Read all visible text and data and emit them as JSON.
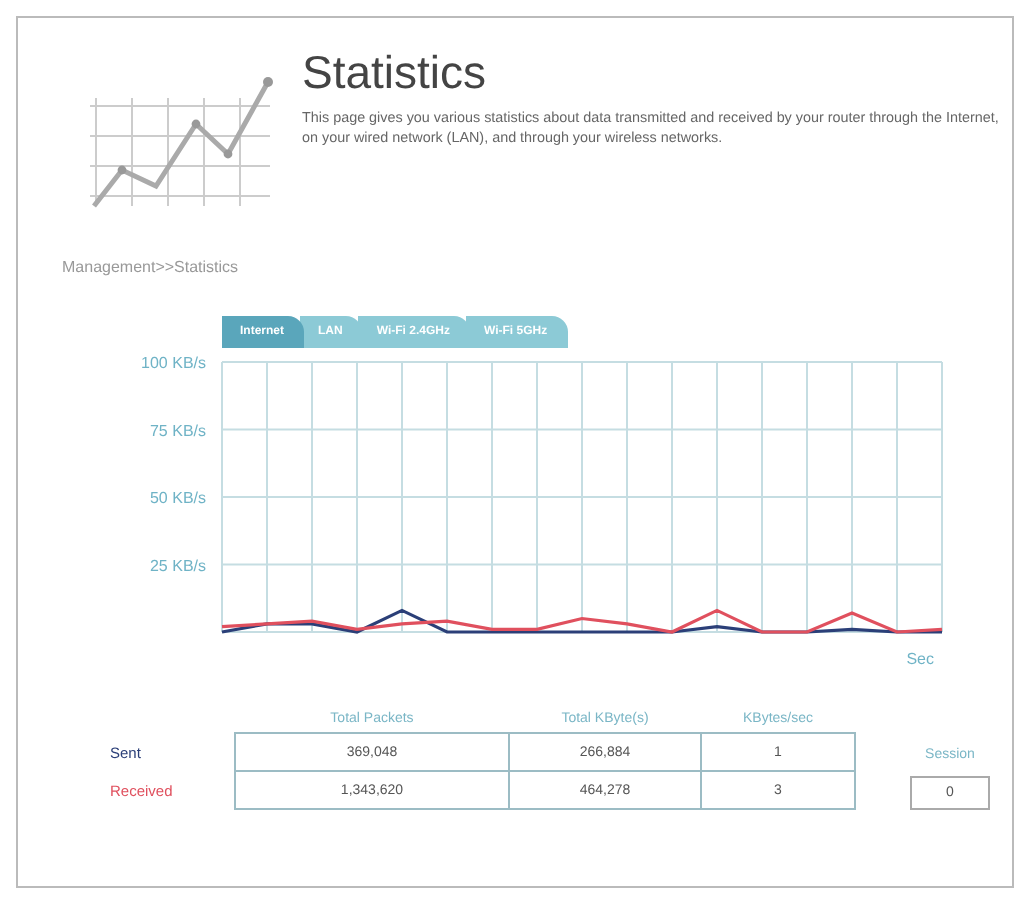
{
  "header": {
    "title": "Statistics",
    "description": "This page gives you various statistics about data transmitted and received by your router through the Internet, on your wired network (LAN), and through your wireless networks."
  },
  "breadcrumb": "Management>>Statistics",
  "tabs": [
    {
      "label": "Internet",
      "selected": true
    },
    {
      "label": "LAN",
      "selected": false
    },
    {
      "label": "Wi-Fi 2.4GHz",
      "selected": false
    },
    {
      "label": "Wi-Fi 5GHz",
      "selected": false
    }
  ],
  "chart": {
    "chart_data": {
      "type": "line",
      "grid": true,
      "xlabel": "Sec",
      "ylim": [
        0,
        100
      ],
      "yticks": [
        {
          "value": 25,
          "label": "25 KB/s"
        },
        {
          "value": 50,
          "label": "50 KB/s"
        },
        {
          "value": 75,
          "label": "75 KB/s"
        },
        {
          "value": 100,
          "label": "100 KB/s"
        }
      ],
      "series": [
        {
          "color": "#2b3f78",
          "values": [
            0,
            3,
            3,
            0,
            8,
            0,
            0,
            0,
            0,
            0,
            0,
            2,
            0,
            0,
            1,
            0,
            0
          ]
        },
        {
          "color": "#e0505e",
          "values": [
            2,
            3,
            4,
            1,
            3,
            4,
            1,
            1,
            5,
            3,
            0,
            8,
            0,
            0,
            7,
            0,
            1
          ]
        }
      ]
    }
  },
  "table": {
    "columns": [
      "Total Packets",
      "Total KByte(s)",
      "KBytes/sec"
    ],
    "rows": [
      {
        "label": "Sent",
        "color": "#2b3f78",
        "cells": [
          "369,048",
          "266,884",
          "1"
        ]
      },
      {
        "label": "Received",
        "color": "#e0505e",
        "cells": [
          "1,343,620",
          "464,278",
          "3"
        ]
      }
    ]
  },
  "session": {
    "label": "Session",
    "value": "0"
  }
}
